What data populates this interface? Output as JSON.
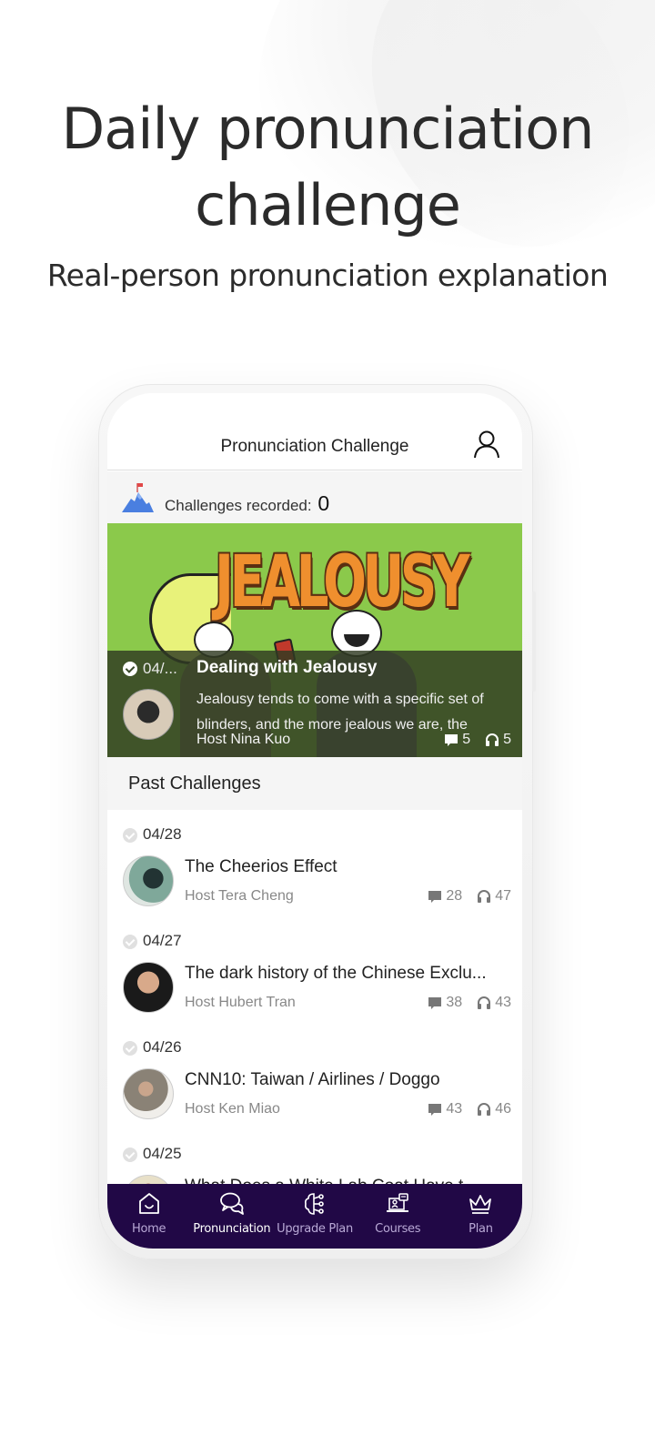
{
  "hero": {
    "title_line1": "Daily pronunciation",
    "title_line2": "challenge",
    "subtitle": "Real-person pronunciation explanation"
  },
  "app": {
    "header_title": "Pronunciation Challenge",
    "header_icon": "user-icon",
    "stats": {
      "label": "Challenges recorded: ",
      "value": "0",
      "icon": "mountain-flag-icon"
    },
    "featured": {
      "banner_text": "JEALOUSY",
      "date": "04/...",
      "title": "Dealing with Jealousy",
      "description": "Jealousy tends to come with a specific set of blinders, and the more jealous we are, the",
      "host": "Host Nina Kuo",
      "comments": "5",
      "listens": "5",
      "completed": true
    },
    "past_header": "Past Challenges",
    "past_challenges": [
      {
        "date": "04/28",
        "title": "The Cheerios Effect",
        "host": "Host Tera Cheng",
        "comments": "28",
        "listens": "47"
      },
      {
        "date": "04/27",
        "title": "The dark history of the Chinese Exclu...",
        "host": "Host Hubert Tran",
        "comments": "38",
        "listens": "43"
      },
      {
        "date": "04/26",
        "title": "CNN10: Taiwan / Airlines / Doggo",
        "host": "Host Ken Miao",
        "comments": "43",
        "listens": "46"
      },
      {
        "date": "04/25",
        "title": "What Does a White Lab Coat Have t...",
        "host": "",
        "comments": "",
        "listens": ""
      }
    ],
    "nav": [
      {
        "label": "Home",
        "icon": "home-icon",
        "active": false
      },
      {
        "label": "Pronunciation",
        "icon": "chat-bubbles-icon",
        "active": true
      },
      {
        "label": "Upgrade Plan",
        "icon": "brain-circuit-icon",
        "active": false
      },
      {
        "label": "Courses",
        "icon": "laptop-course-icon",
        "active": false
      },
      {
        "label": "Plan",
        "icon": "crown-icon",
        "active": false
      }
    ],
    "colors": {
      "nav_bg": "#210846",
      "banner_green": "#8bc94b",
      "banner_orange": "#ef8f2e"
    }
  }
}
